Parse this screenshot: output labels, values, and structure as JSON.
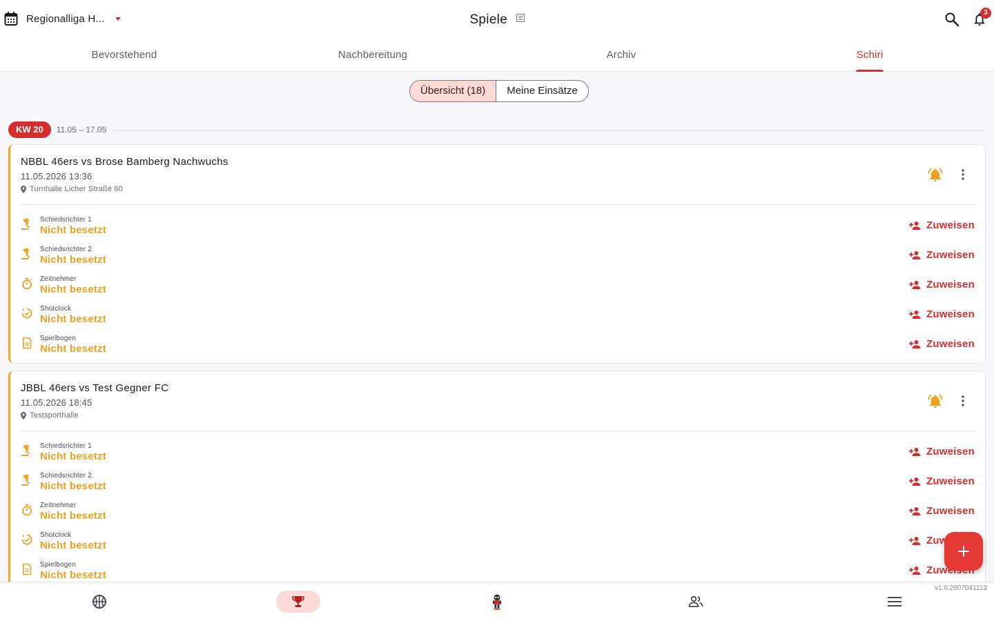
{
  "header": {
    "league_name": "Regionalliga H...",
    "title": "Spiele",
    "notification_count": "3"
  },
  "tabs": [
    {
      "label": "Bevorstehend"
    },
    {
      "label": "Nachbereitung"
    },
    {
      "label": "Archiv"
    },
    {
      "label": "Schiri"
    }
  ],
  "segmented": {
    "overview": "Übersicht (18)",
    "mine": "Meine Einsätze"
  },
  "week": {
    "label": "KW 20",
    "range": "11.05 – 17.05"
  },
  "games": [
    {
      "title": "NBBL 46ers vs Brose Bamberg Nachwuchs",
      "datetime": "11.05.2026 13:36",
      "venue": "Turnhalle Licher Straße 60",
      "roles": [
        {
          "label": "Schiedsrichter 1",
          "value": "Nicht besetzt",
          "action": "Zuweisen"
        },
        {
          "label": "Schiedsrichter 2",
          "value": "Nicht besetzt",
          "action": "Zuweisen"
        },
        {
          "label": "Zeitnehmer",
          "value": "Nicht besetzt",
          "action": "Zuweisen"
        },
        {
          "label": "Shotclock",
          "value": "Nicht besetzt",
          "action": "Zuweisen"
        },
        {
          "label": "Spielbogen",
          "value": "Nicht besetzt",
          "action": "Zuweisen"
        }
      ]
    },
    {
      "title": "JBBL 46ers vs Test Gegner FC",
      "datetime": "11.05.2026 18:45",
      "venue": "Testsporthalle",
      "roles": [
        {
          "label": "Schiedsrichter 1",
          "value": "Nicht besetzt",
          "action": "Zuweisen"
        },
        {
          "label": "Schiedsrichter 2",
          "value": "Nicht besetzt",
          "action": "Zuweisen"
        },
        {
          "label": "Zeitnehmer",
          "value": "Nicht besetzt",
          "action": "Zuweisen"
        },
        {
          "label": "Shotclock",
          "value": "Nicht besetzt",
          "action": "Zuweisen"
        },
        {
          "label": "Spielbogen",
          "value": "Nicht besetzt",
          "action": "Zuweisen"
        }
      ]
    }
  ],
  "version": "v1.0.2607041113",
  "bottom_nav": [
    {
      "icon": "basketball-icon"
    },
    {
      "icon": "trophy-icon",
      "active": true
    },
    {
      "icon": "mascot-icon"
    },
    {
      "icon": "people-icon"
    },
    {
      "icon": "menu-icon"
    }
  ],
  "colors": {
    "accent": "#d32f2f",
    "warning": "#f0a020",
    "selected_bg": "#fbd9d6"
  }
}
